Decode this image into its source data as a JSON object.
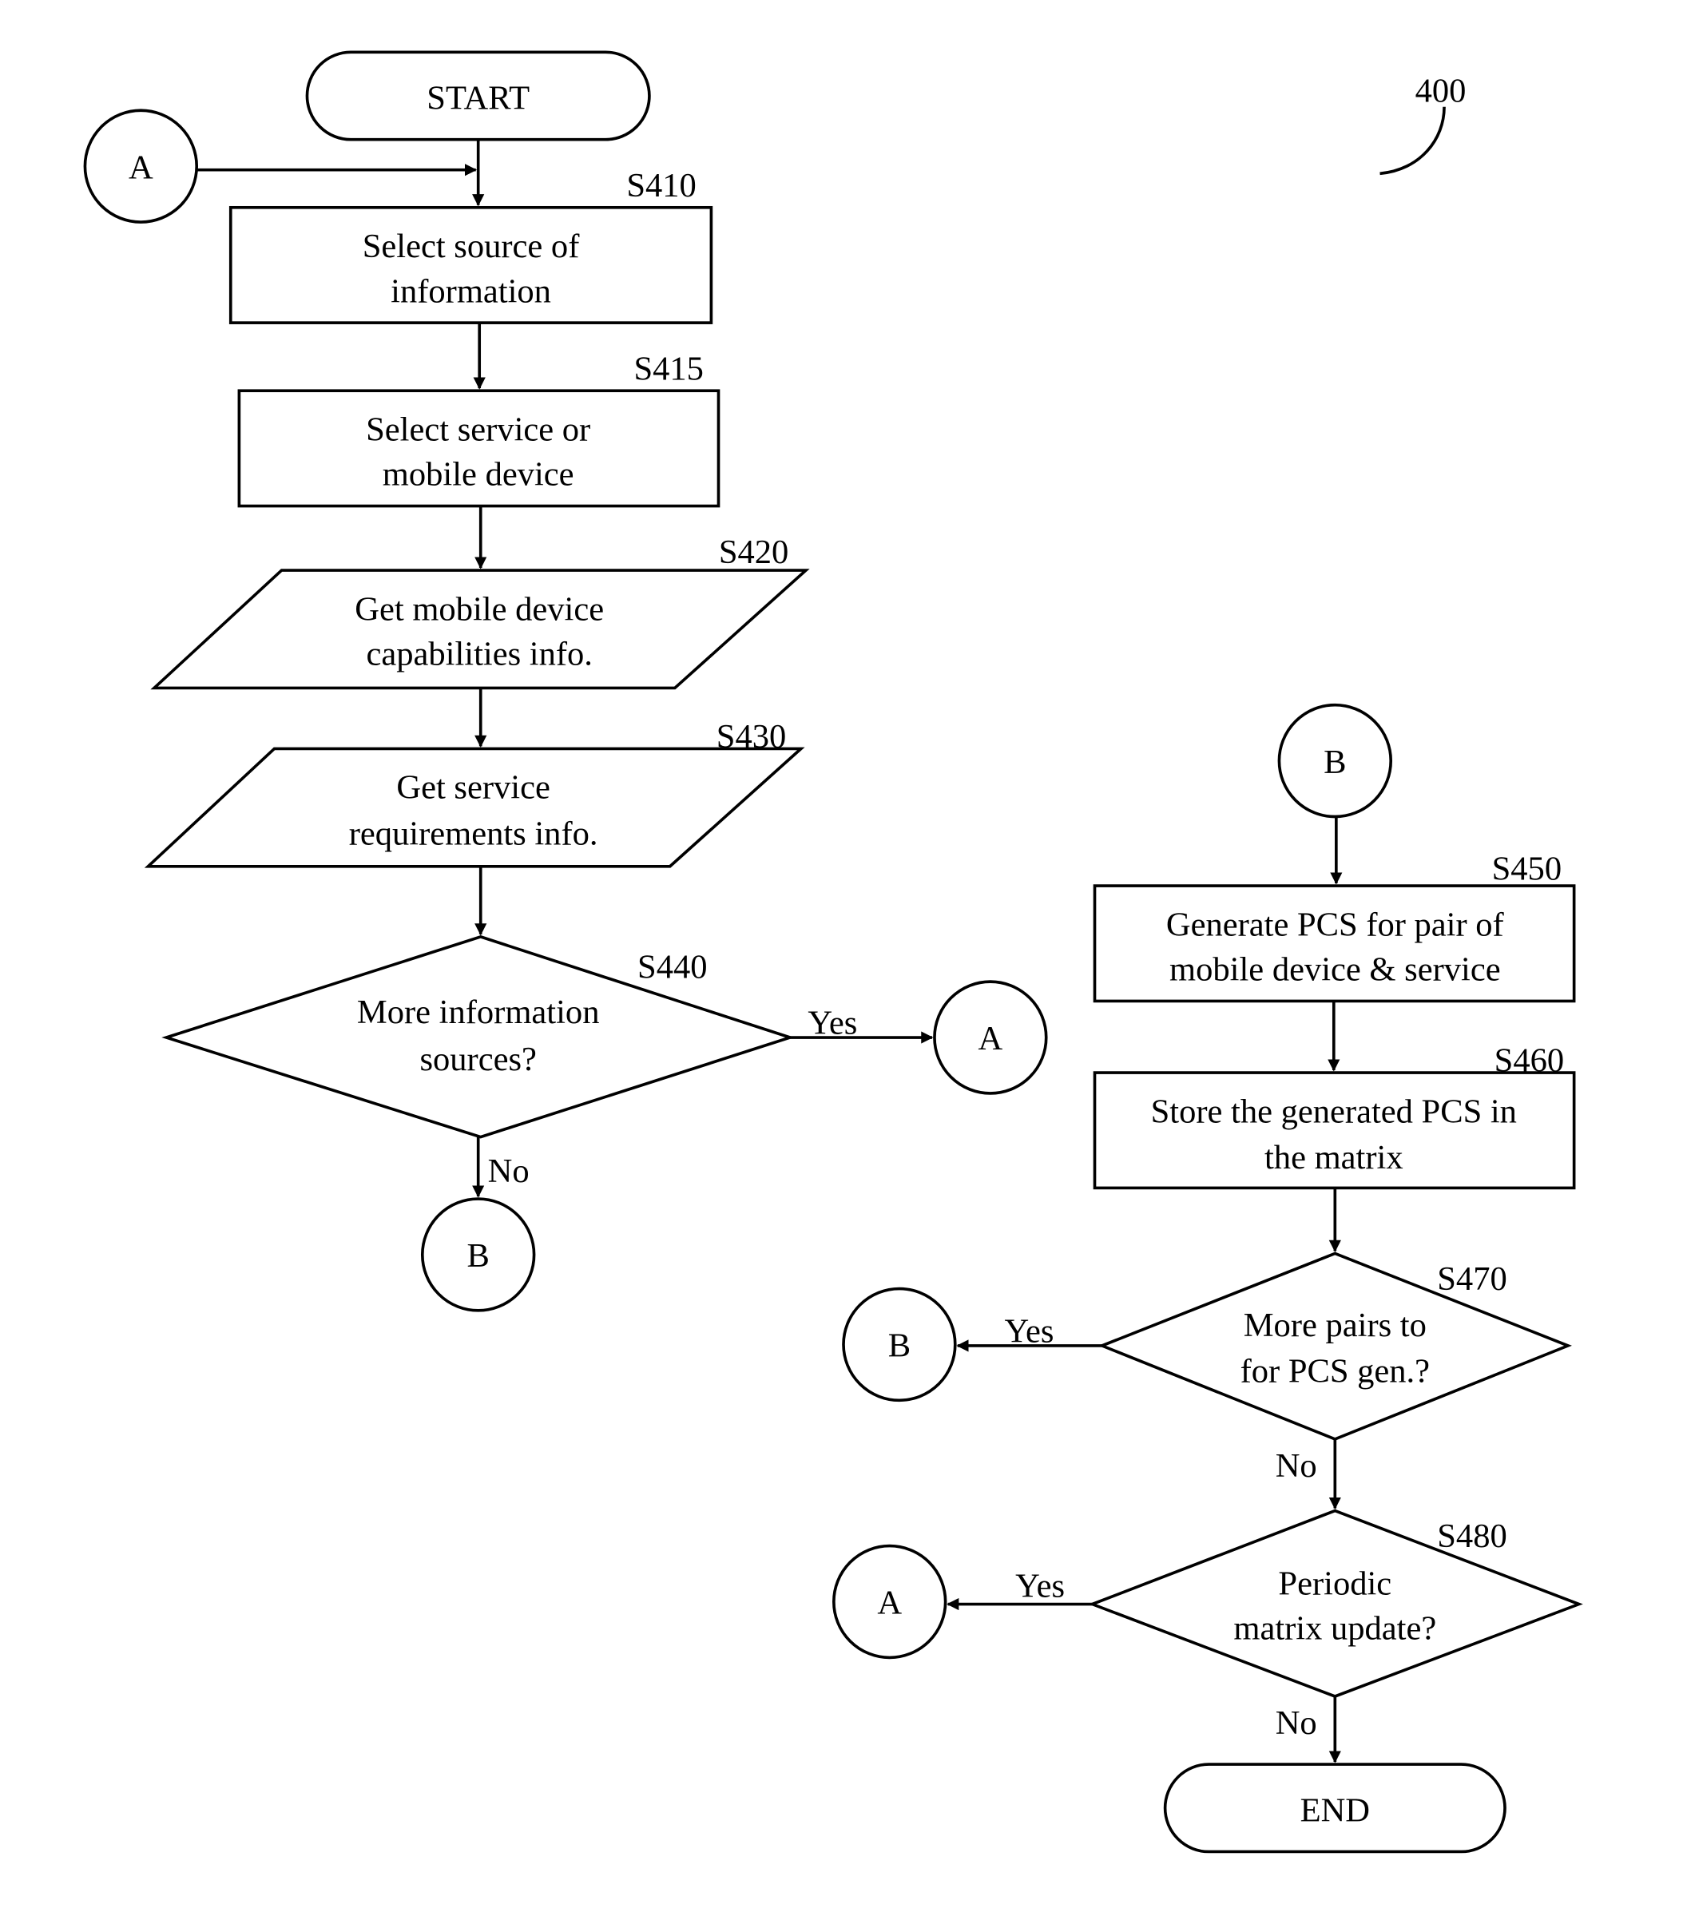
{
  "figure": {
    "reference_number": "400"
  },
  "nodes": {
    "start": {
      "text": "START"
    },
    "end": {
      "text": "END"
    },
    "s410": {
      "step": "S410",
      "lines": [
        "Select source of",
        "information"
      ]
    },
    "s415": {
      "step": "S415",
      "lines": [
        "Select service or",
        "mobile device"
      ]
    },
    "s420": {
      "step": "S420",
      "lines": [
        "Get mobile device",
        "capabilities info."
      ]
    },
    "s430": {
      "step": "S430",
      "lines": [
        "Get service",
        "requirements info."
      ]
    },
    "s440": {
      "step": "S440",
      "lines": [
        "More information",
        "sources?"
      ],
      "yes": "Yes",
      "no": "No"
    },
    "s450": {
      "step": "S450",
      "lines": [
        "Generate PCS for pair of",
        "mobile device & service"
      ]
    },
    "s460": {
      "step": "S460",
      "lines": [
        "Store the generated PCS in",
        "the matrix"
      ]
    },
    "s470": {
      "step": "S470",
      "lines": [
        "More pairs to",
        "for PCS gen.?"
      ],
      "yes": "Yes",
      "no": "No"
    },
    "s480": {
      "step": "S480",
      "lines": [
        "Periodic",
        "matrix update?"
      ],
      "yes": "Yes",
      "no": "No"
    }
  },
  "connectors": {
    "a_entry": "A",
    "a_from_s440": "A",
    "b_from_s440": "B",
    "b_entry": "B",
    "b_from_s470": "B",
    "a_from_s480": "A"
  }
}
